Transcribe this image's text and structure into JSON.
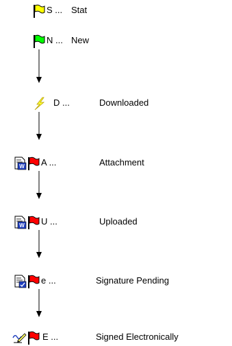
{
  "legend": [
    {
      "code": "S ...",
      "label": "Stat",
      "flag": "yellow",
      "colors": {
        "flag": "#ffff00"
      },
      "doc_icon": ""
    },
    {
      "code": "N ...",
      "label": "New",
      "flag": "green",
      "colors": {
        "flag": "#00ff00"
      },
      "doc_icon": ""
    },
    {
      "code": "D ...",
      "label": "Downloaded",
      "flag": "lightning",
      "colors": {
        "flag": "#ffff33"
      },
      "doc_icon": ""
    },
    {
      "code": "A ...",
      "label": "Attachment",
      "flag": "red",
      "colors": {
        "flag": "#ff0000"
      },
      "doc_icon": "word-document-icon"
    },
    {
      "code": "U ...",
      "label": "Uploaded",
      "flag": "red",
      "colors": {
        "flag": "#ff0000"
      },
      "doc_icon": "word-document-icon"
    },
    {
      "code": "e ...",
      "label": "Signature Pending",
      "flag": "red",
      "colors": {
        "flag": "#ff0000"
      },
      "doc_icon": "signed-document-icon"
    },
    {
      "code": "E ...",
      "label": "Signed Electronically",
      "flag": "red",
      "colors": {
        "flag": "#ff0000"
      },
      "doc_icon": "pen-signature-icon"
    }
  ],
  "colors": {
    "arrow": "#000000",
    "flag_outline": "#000000",
    "doc_blue": "#1f3fbf"
  }
}
